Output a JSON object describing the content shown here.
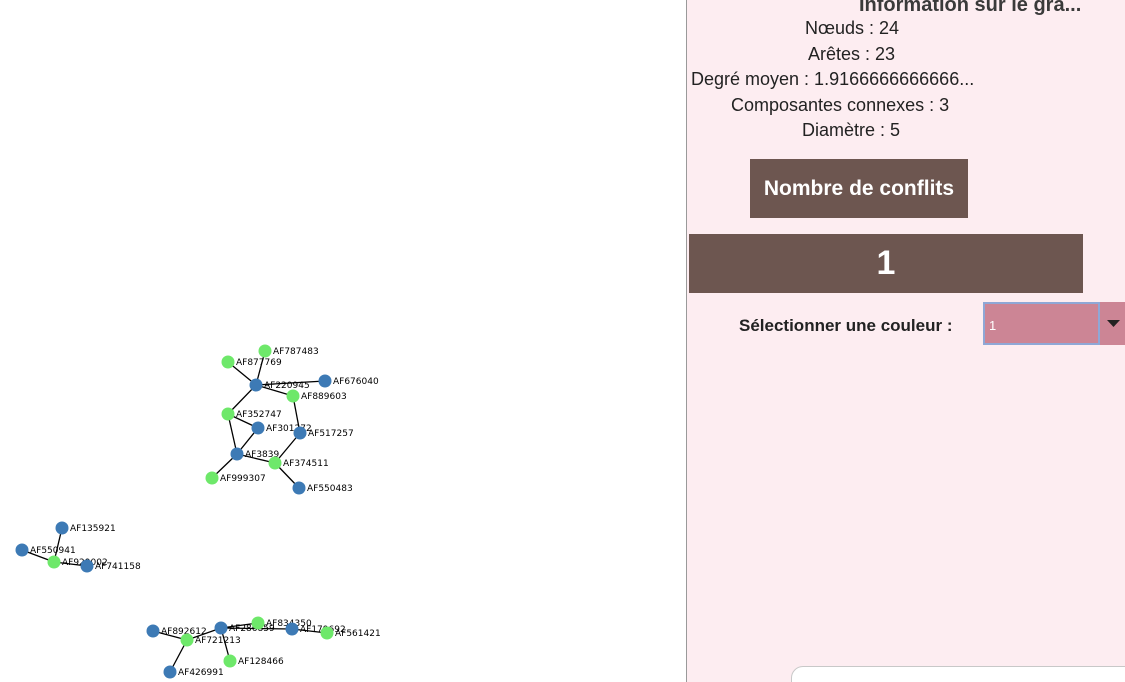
{
  "graph": {
    "colors": {
      "blue": "#3d7ab5",
      "green": "#6ee86a",
      "edge": "#000000"
    },
    "nodes": [
      {
        "id": "AF787483",
        "color": "green"
      },
      {
        "id": "AF877769",
        "color": "green"
      },
      {
        "id": "AF220945",
        "color": "blue"
      },
      {
        "id": "AF676040",
        "color": "blue"
      },
      {
        "id": "AF889603",
        "color": "green"
      },
      {
        "id": "AF352747",
        "color": "green"
      },
      {
        "id": "AF301272",
        "color": "blue"
      },
      {
        "id": "AF517257",
        "color": "blue"
      },
      {
        "id": "AF3839",
        "color": "blue"
      },
      {
        "id": "AF374511",
        "color": "green"
      },
      {
        "id": "AF999307",
        "color": "green"
      },
      {
        "id": "AF550483",
        "color": "blue"
      },
      {
        "id": "AF135921",
        "color": "blue"
      },
      {
        "id": "AF550941",
        "color": "blue"
      },
      {
        "id": "AF929002",
        "color": "green"
      },
      {
        "id": "AF741158",
        "color": "blue"
      },
      {
        "id": "AF892612",
        "color": "blue"
      },
      {
        "id": "AF721213",
        "color": "green"
      },
      {
        "id": "AF286859",
        "color": "blue"
      },
      {
        "id": "AF834350",
        "color": "green"
      },
      {
        "id": "AF179692",
        "color": "blue"
      },
      {
        "id": "AF561421",
        "color": "green"
      },
      {
        "id": "AF128466",
        "color": "green"
      },
      {
        "id": "AF426991",
        "color": "blue"
      }
    ],
    "edges": [
      [
        "AF787483",
        "AF220945"
      ],
      [
        "AF877769",
        "AF220945"
      ],
      [
        "AF220945",
        "AF676040"
      ],
      [
        "AF220945",
        "AF889603"
      ],
      [
        "AF220945",
        "AF352747"
      ],
      [
        "AF889603",
        "AF517257"
      ],
      [
        "AF352747",
        "AF301272"
      ],
      [
        "AF352747",
        "AF3839"
      ],
      [
        "AF301272",
        "AF3839"
      ],
      [
        "AF517257",
        "AF374511"
      ],
      [
        "AF3839",
        "AF374511"
      ],
      [
        "AF3839",
        "AF999307"
      ],
      [
        "AF374511",
        "AF550483"
      ],
      [
        "AF135921",
        "AF929002"
      ],
      [
        "AF550941",
        "AF929002"
      ],
      [
        "AF929002",
        "AF741158"
      ],
      [
        "AF892612",
        "AF721213"
      ],
      [
        "AF721213",
        "AF286859"
      ],
      [
        "AF721213",
        "AF426991"
      ],
      [
        "AF286859",
        "AF834350"
      ],
      [
        "AF286859",
        "AF179692"
      ],
      [
        "AF286859",
        "AF128466"
      ],
      [
        "AF179692",
        "AF561421"
      ]
    ]
  },
  "panel": {
    "title": "Information sur le gra...",
    "nodes_text": "Nœuds : 24",
    "edges_text": "Arêtes : 23",
    "avg_degree_text": "Degré moyen : 1.9166666666666...",
    "components_text": "Composantes connexes : 3",
    "diameter_text": "Diamètre : 5",
    "conflicts_button_label": "Nombre de conflits",
    "conflicts_value": "1",
    "color_select_label": "Sélectionner une couleur :",
    "color_select_value": "1",
    "background_color": "#fdedf1",
    "button_color": "#6d5650",
    "select_color": "#cc8595"
  }
}
